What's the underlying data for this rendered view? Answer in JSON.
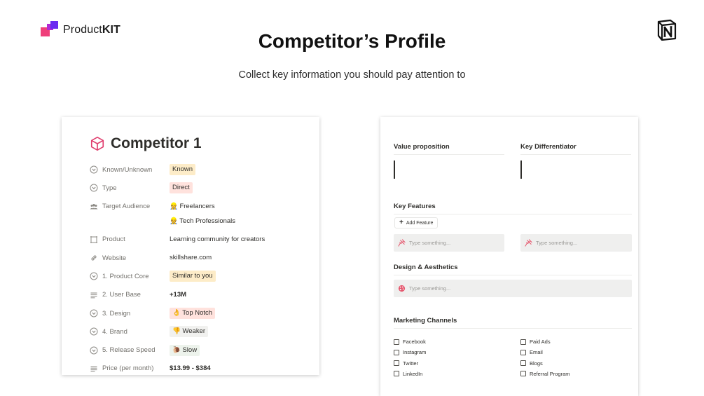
{
  "brand": {
    "name_prefix": "Product",
    "name_suffix": "KIT",
    "colors": [
      "#ef3f7a",
      "#b02ad6",
      "#6b2bf0"
    ]
  },
  "header": {
    "title": "Competitor’s Profile",
    "subtitle": "Collect key information you should pay attention to",
    "notion_icon": "notion-logo-icon"
  },
  "competitor": {
    "title": "Competitor 1",
    "icon": "cube-icon",
    "properties": [
      {
        "key": "Known/Unknown",
        "icon": "circle-chevron-icon",
        "values": [
          {
            "text": "Known",
            "tag": "#fdecc8"
          }
        ]
      },
      {
        "key": "Type",
        "icon": "circle-chevron-icon",
        "values": [
          {
            "text": "Direct",
            "tag": "#ffe2dd"
          }
        ]
      },
      {
        "key": "Target Audience",
        "icon": "people-icon",
        "values": [
          {
            "text": "👷 Freelancers"
          },
          {
            "text": "👷 Tech Professionals"
          }
        ]
      },
      {
        "key": "Product",
        "icon": "frame-icon",
        "values": [
          {
            "text": "Learning community for creators"
          }
        ]
      },
      {
        "key": "Website",
        "icon": "link-icon",
        "values": [
          {
            "text": "skillshare.com"
          }
        ]
      },
      {
        "key": "1. Product Core",
        "icon": "circle-chevron-icon",
        "values": [
          {
            "text": "Similar to you",
            "tag": "#fdecc8"
          }
        ]
      },
      {
        "key": "2. User Base",
        "icon": "lines-icon",
        "values": [
          {
            "text": "+13M",
            "bold": true
          }
        ]
      },
      {
        "key": "3. Design",
        "icon": "circle-chevron-icon",
        "values": [
          {
            "text": "👌 Top Notch",
            "tag": "#ffe2dd"
          }
        ]
      },
      {
        "key": "4. Brand",
        "icon": "circle-chevron-icon",
        "values": [
          {
            "text": "👎 Weaker",
            "tag": "#f1f1ef"
          }
        ]
      },
      {
        "key": "5. Release Speed",
        "icon": "circle-chevron-icon",
        "values": [
          {
            "text": "🐌 Slow",
            "tag": "#edf3ec"
          }
        ]
      },
      {
        "key": "Price (per month)",
        "icon": "lines-icon",
        "values": [
          {
            "text": "$13.99 - $384",
            "bold": true
          }
        ]
      }
    ]
  },
  "details": {
    "value_proposition": "Value proposition",
    "key_differentiator": "Key Differentiator",
    "key_features": "Key Features",
    "add_feature": "Add Feature",
    "feature_placeholder_1": "Type something...",
    "feature_placeholder_2": "Type something...",
    "design_aesthetics": "Design & Aesthetics",
    "design_placeholder": "Type something...",
    "marketing_channels": "Marketing Channels",
    "channels_left": [
      "Facebook",
      "Instagram",
      "Twitter",
      "LinkedIn"
    ],
    "channels_right": [
      "Paid Ads",
      "Email",
      "Blogs",
      "Referral Program"
    ]
  }
}
